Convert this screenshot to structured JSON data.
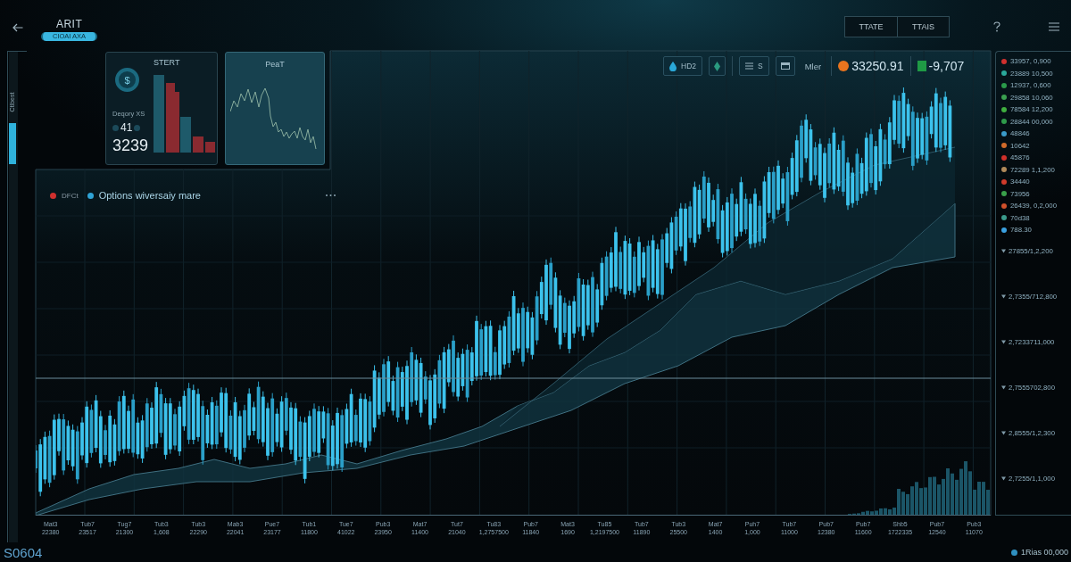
{
  "header": {
    "title": "ARIT",
    "subtitle": "CIOAI AXA",
    "tabs": [
      {
        "label": "TTATE",
        "selected": false
      },
      {
        "label": "TTAIS",
        "selected": false
      }
    ]
  },
  "sidebar": {
    "label": "Ctlbest"
  },
  "cards": [
    {
      "kind": "stats",
      "symbol": "$",
      "title": "STERT",
      "caption": "Deqory XS",
      "count": "41",
      "total": "3239"
    },
    {
      "kind": "trend",
      "title": "PeaT"
    }
  ],
  "toolbar": {
    "chips": [
      "HD2",
      "S"
    ],
    "label": "Mler",
    "quotes": [
      {
        "kind": "dot",
        "value": "33250.91",
        "color": "#e8741e"
      },
      {
        "kind": "square",
        "value": "-9,707",
        "color": "#1f9a45"
      }
    ]
  },
  "legend": [
    {
      "label": "DFCt",
      "color": "#d0302e"
    },
    {
      "label": "Options wiversaiy mare",
      "color": "#2fa3d6"
    }
  ],
  "chart": {
    "x_labels": [
      {
        "name": "Mat3",
        "value": "22380"
      },
      {
        "name": "Tub7",
        "value": "23517"
      },
      {
        "name": "Tug7",
        "value": "21300"
      },
      {
        "name": "Tub3",
        "value": "1,608"
      },
      {
        "name": "Tub3",
        "value": "22290"
      },
      {
        "name": "Mab3",
        "value": "22041"
      },
      {
        "name": "Pue7",
        "value": "23177"
      },
      {
        "name": "Tub1",
        "value": "11800"
      },
      {
        "name": "Tue7",
        "value": "41022"
      },
      {
        "name": "Pub3",
        "value": "23950"
      },
      {
        "name": "Mat7",
        "value": "11400"
      },
      {
        "name": "Tut7",
        "value": "21040"
      },
      {
        "name": "Tu83",
        "value": "1,2757500"
      },
      {
        "name": "Pub7",
        "value": "11840"
      },
      {
        "name": "Mat3",
        "value": "1690"
      },
      {
        "name": "Tu85",
        "value": "1,2197500"
      },
      {
        "name": "Tub7",
        "value": "11890"
      },
      {
        "name": "Tub3",
        "value": "25500"
      },
      {
        "name": "Mat7",
        "value": "1400"
      },
      {
        "name": "Puh7",
        "value": "1,000"
      },
      {
        "name": "Tub7",
        "value": "11000"
      },
      {
        "name": "Pub7",
        "value": "12380"
      },
      {
        "name": "Pub7",
        "value": "11600"
      },
      {
        "name": "Shb5",
        "value": "1722335"
      },
      {
        "name": "Pub7",
        "value": "12540"
      },
      {
        "name": "Pub3",
        "value": "11070"
      }
    ]
  },
  "series_list": [
    {
      "label": "33957, 0,900",
      "color": "#d0302e"
    },
    {
      "label": "23889 10,500",
      "color": "#2aa89a"
    },
    {
      "label": "12937, 0,600",
      "color": "#2a9a4a"
    },
    {
      "label": "29858 10,060",
      "color": "#3aa050"
    },
    {
      "label": "78584 12,200",
      "color": "#3fae3f"
    },
    {
      "label": "28844 00,000",
      "color": "#2e9a4a"
    },
    {
      "label": "48846",
      "color": "#3a9ac8"
    },
    {
      "label": "10642",
      "color": "#d06a2a"
    },
    {
      "label": "45876",
      "color": "#d0302a"
    },
    {
      "label": "72289 1,1,200",
      "color": "#b08a5a"
    },
    {
      "label": "34440",
      "color": "#d03a2a"
    },
    {
      "label": "73956",
      "color": "#3aa04a"
    },
    {
      "label": "26439, 0,2,000",
      "color": "#d0502a"
    },
    {
      "label": "70d38",
      "color": "#3a9a8a"
    },
    {
      "label": "788.30",
      "color": "#3aa0e0"
    }
  ],
  "y_labels": [
    "27855/1,2,200",
    "2,7355/712,800",
    "2,7233711,000",
    "2,7555702,800",
    "2,8555/1,2,300",
    "2,7255/1,1,000"
  ],
  "footer": {
    "code": "S0604",
    "status": {
      "label": "1Rias 00,000",
      "color": "#2f8fbf"
    }
  }
}
